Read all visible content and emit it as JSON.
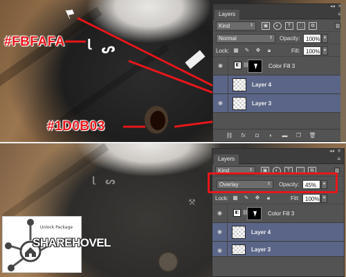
{
  "colors": {
    "annotation_red": "#e8161a",
    "panel_bg": "#535353",
    "selected_layer": "#5a6587",
    "insignia_color": "#FBFAFA",
    "button_color": "#1D0B03"
  },
  "annotations": {
    "label_light": "#FBFAFA",
    "label_dark": "#1D0B03"
  },
  "top_panel": {
    "tab": "Layers",
    "filter_select": "Kind",
    "blend_mode": "Normal",
    "opacity_label": "Opacity:",
    "opacity_value": "100%",
    "lock_label": "Lock:",
    "fill_label": "Fill:",
    "fill_value": "100%",
    "layers": [
      {
        "name": "Color Fill 3",
        "type": "fill"
      },
      {
        "name": "Layer 4",
        "type": "pixel"
      },
      {
        "name": "Layer 3",
        "type": "pixel"
      }
    ]
  },
  "bottom_panel": {
    "tab": "Layers",
    "filter_select": "Kind",
    "blend_mode": "Overlay",
    "opacity_label": "Opacity:",
    "opacity_value": "45%",
    "lock_label": "Lock:",
    "fill_label": "Fill:",
    "fill_value": "100%",
    "layers": [
      {
        "name": "Color Fill 3",
        "type": "fill"
      },
      {
        "name": "Layer 4",
        "type": "pixel"
      },
      {
        "name": "Layer 3",
        "type": "pixel"
      }
    ]
  },
  "icons": {
    "panel_menu": "menu-icon",
    "eye": "eye-icon",
    "link": "link-icon",
    "filter_pixel": "image-icon",
    "filter_adjust": "adjustment-icon",
    "filter_type": "type-icon",
    "filter_shape": "shape-icon",
    "filter_smart": "smart-object-icon"
  },
  "logo": {
    "tagline": "Unlock Package",
    "name": "SHAREHOVEL"
  }
}
